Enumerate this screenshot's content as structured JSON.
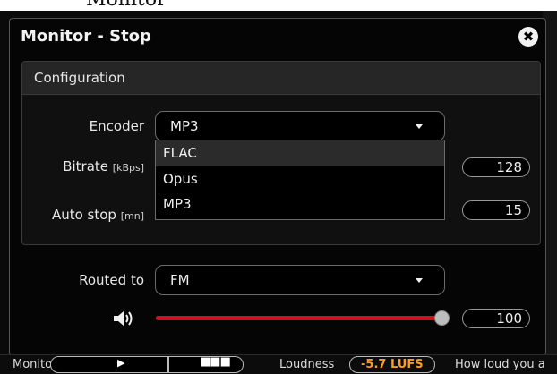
{
  "background": {
    "window_label": "Monitor"
  },
  "dialog": {
    "title": "Monitor - Stop",
    "close_icon": "close-icon",
    "configuration": {
      "header": "Configuration",
      "encoder": {
        "label": "Encoder",
        "selected": "MP3",
        "options": [
          "FLAC",
          "Opus",
          "MP3"
        ],
        "highlighted": "FLAC"
      },
      "bitrate": {
        "label": "Bitrate",
        "unit": "[kBps]",
        "value": "128"
      },
      "autostop": {
        "label": "Auto stop",
        "unit": "[mn]",
        "value": "15"
      }
    },
    "routing": {
      "label": "Routed to",
      "selected": "FM"
    },
    "volume": {
      "icon": "speaker-icon",
      "value": "100",
      "level": 1.0
    }
  },
  "statusbar": {
    "monitor_label": "Monitor",
    "play_icon": "play-icon",
    "stop_icon": "stop-icon",
    "play_glyph": "▶",
    "stop_glyph": "■■■",
    "loudness_label": "Loudness",
    "loudness_value": "-5.7 LUFS",
    "hint": "How loud you a"
  },
  "colors": {
    "accent_red": "#d4101c",
    "loudness_orange": "#ff9a1a"
  }
}
